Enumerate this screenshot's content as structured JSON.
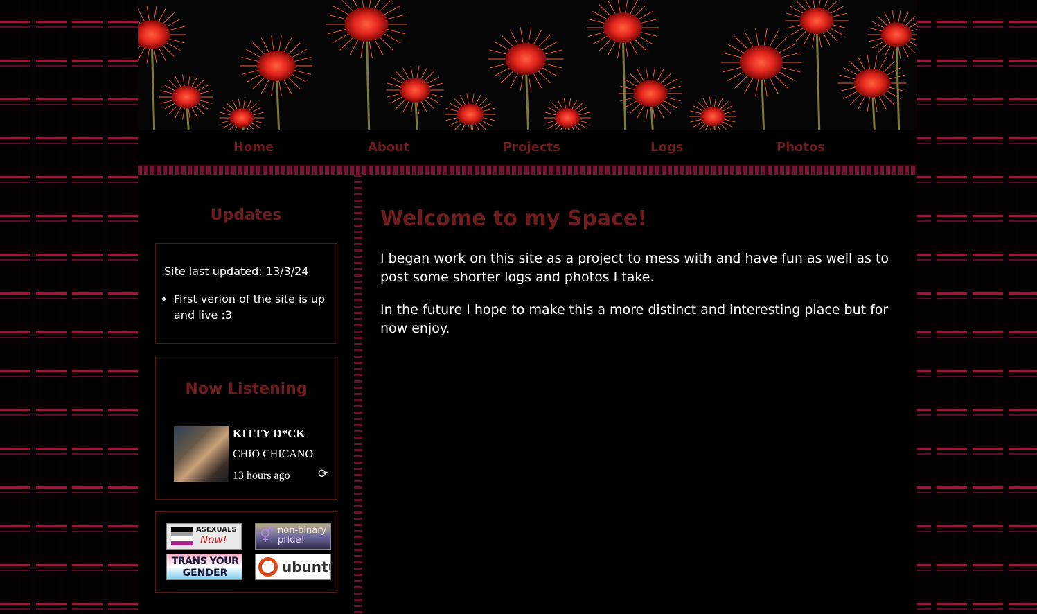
{
  "nav": {
    "items": [
      {
        "label": "Home"
      },
      {
        "label": "About"
      },
      {
        "label": "Projects"
      },
      {
        "label": "Logs"
      },
      {
        "label": "Photos"
      }
    ]
  },
  "sidebar": {
    "updates": {
      "title": "Updates",
      "last_updated": "Site last updated: 13/3/24",
      "items": [
        "First verion of the site is up and live :3"
      ]
    },
    "now_listening": {
      "title": "Now Listening",
      "track": "KITTY D*CK",
      "artist": "CHIO CHICANO",
      "time": "13 hours ago"
    },
    "badges": {
      "asexuals_top": "ASEXUALS",
      "asexuals_bottom": "Now!",
      "nonbinary_top": "non-binary",
      "nonbinary_bottom": "pride!",
      "trans_top": "TRANS YOUR",
      "trans_bottom": "GENDER",
      "ubuntu": "ubuntu"
    }
  },
  "main": {
    "title": "Welcome to my Space!",
    "paragraphs": [
      "I began work on this site as a project to mess with and have fun as well as to post some shorter logs and photos I take.",
      "In the future I hope to make this a more distinct and interesting place but for now enjoy."
    ]
  },
  "colors": {
    "accent": "#6e1c1c",
    "background": "#000000",
    "stripe": "#e8336a",
    "text": "#ffffff"
  }
}
